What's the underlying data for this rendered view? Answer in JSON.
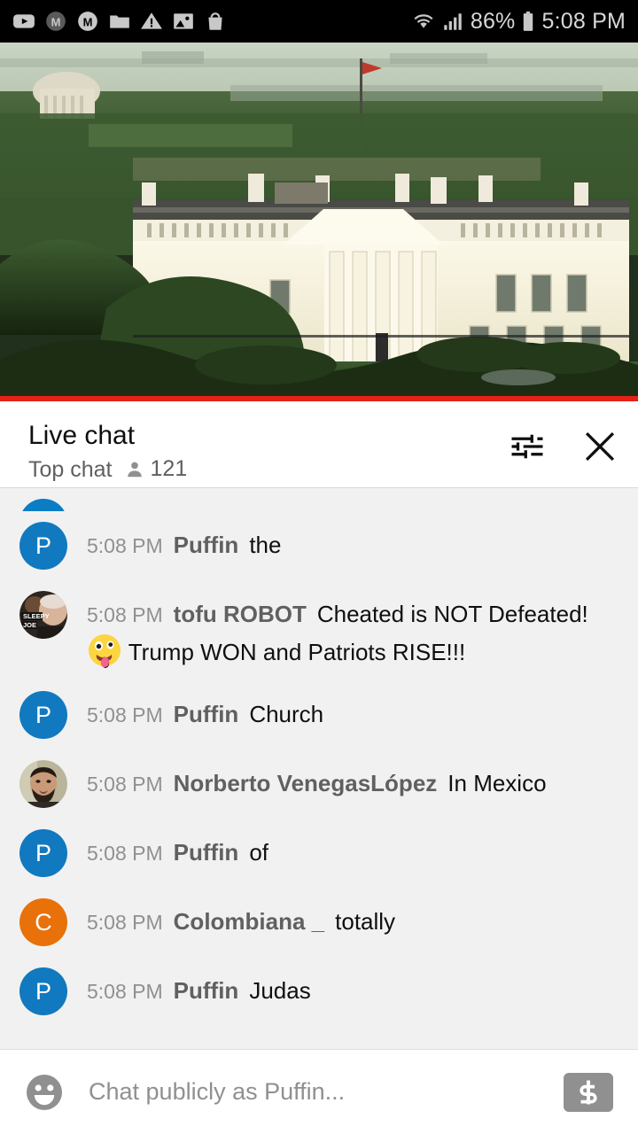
{
  "statusbar": {
    "icons": [
      "youtube-icon",
      "m-filled-icon",
      "m-outline-icon",
      "folder-icon",
      "warning-triangle-icon",
      "image-icon",
      "shopping-bag-icon"
    ],
    "wifi_icon": "wifi-icon",
    "signal_icon": "cell-signal-icon",
    "battery_percent": "86%",
    "battery_icon": "battery-icon",
    "clock": "5:08 PM"
  },
  "video": {
    "alt": "White House north portico live stream",
    "progress_percent": 100,
    "progress_color": "#e62117"
  },
  "chat_header": {
    "title": "Live chat",
    "mode": "Top chat",
    "viewer_count": "121",
    "viewer_icon": "person-icon",
    "settings_icon": "tune-icon",
    "close_icon": "close-icon"
  },
  "messages": [
    {
      "id": "clipped-top",
      "clipped": true,
      "time": "",
      "author": "",
      "text": "",
      "avatar": {
        "type": "initial",
        "letter": "",
        "color": "#0b7dc4"
      }
    },
    {
      "id": "m1",
      "time": "5:08 PM",
      "author": "Puffin",
      "text": "the",
      "avatar": {
        "type": "initial",
        "letter": "P",
        "color": "#1179bf"
      }
    },
    {
      "id": "m2",
      "time": "5:08 PM",
      "author": "tofu ROBOT",
      "text": "Cheated is NOT Defeated!",
      "emoji": "zany-face-emoji",
      "text2": "Trump WON and Patriots RISE!!!",
      "avatar": {
        "type": "photo",
        "photo": "sleepy-joe-meme-avatar",
        "label": "SLEEPY JOE"
      }
    },
    {
      "id": "m3",
      "time": "5:08 PM",
      "author": "Puffin",
      "text": "Church",
      "avatar": {
        "type": "initial",
        "letter": "P",
        "color": "#1179bf"
      }
    },
    {
      "id": "m4",
      "time": "5:08 PM",
      "author": "Norberto VenegasLópez",
      "text": "In Mexico",
      "avatar": {
        "type": "photo",
        "photo": "bearded-man-avatar"
      }
    },
    {
      "id": "m5",
      "time": "5:08 PM",
      "author": "Puffin",
      "text": "of",
      "avatar": {
        "type": "initial",
        "letter": "P",
        "color": "#1179bf"
      }
    },
    {
      "id": "m6",
      "time": "5:08 PM",
      "author": "Colombiana _",
      "text": "totally",
      "avatar": {
        "type": "initial",
        "letter": "C",
        "color": "#e8710a"
      }
    },
    {
      "id": "m7",
      "time": "5:08 PM",
      "author": "Puffin",
      "text": "Judas",
      "avatar": {
        "type": "initial",
        "letter": "P",
        "color": "#1179bf"
      }
    }
  ],
  "composer": {
    "emoji_icon": "emoji-smiley-icon",
    "placeholder": "Chat publicly as Puffin...",
    "value": "",
    "superchat_icon": "dollar-superchat-icon"
  },
  "colors": {
    "accent_red": "#e62117",
    "chat_bg": "#f1f1f1",
    "avatar_blue": "#1179bf",
    "avatar_orange": "#e8710a",
    "muted_text": "#909090"
  }
}
